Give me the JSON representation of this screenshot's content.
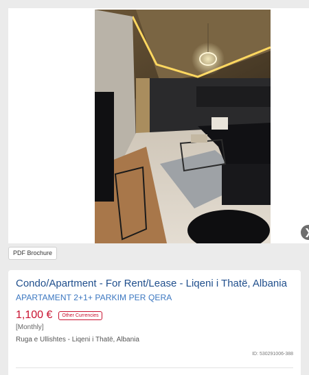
{
  "gallery": {
    "photo_icon": "listing-photo",
    "next_icon": "chevron-right-icon",
    "next_glyph": "❯"
  },
  "brochure": {
    "label": "PDF Brochure"
  },
  "listing": {
    "title": "Condo/Apartment - For Rent/Lease - Liqeni i Thatë, Albania",
    "subtitle": "APARTAMENT 2+1+ PARKIM PER QERA",
    "price": "1,100 €",
    "currency_button": "Other Currencies",
    "period": "[Monthly]",
    "location": "Ruga e Ullishtes - Liqeni i Thatë, Albania",
    "id_text": "ID: 530291006-388"
  },
  "colors": {
    "title_blue": "#1f4e8c",
    "subtitle_blue": "#3a76c0",
    "price_red": "#c8102e"
  }
}
